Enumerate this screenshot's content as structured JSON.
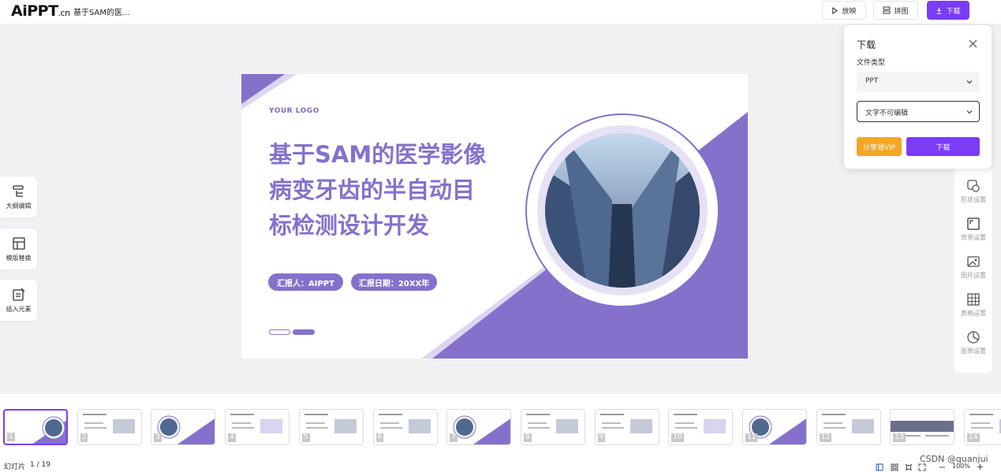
{
  "app": {
    "logo_main": "AiPPT",
    "logo_suffix": ".cn",
    "doc_title": "基于SAM的医..."
  },
  "toolbar": {
    "play_label": "放映",
    "collage_label": "拼图",
    "download_label": "下载",
    "accent_color": "#7b3cf5"
  },
  "left_tools": [
    {
      "label": "大纲编辑",
      "icon": "outline-icon"
    },
    {
      "label": "模版替换",
      "icon": "template-icon"
    },
    {
      "label": "插入元素",
      "icon": "insert-element-icon"
    }
  ],
  "right_tools": [
    {
      "label": "形状设置",
      "icon": "shape-icon"
    },
    {
      "label": "背景设置",
      "icon": "background-icon"
    },
    {
      "label": "图片设置",
      "icon": "image-icon"
    },
    {
      "label": "表格设置",
      "icon": "table-icon"
    },
    {
      "label": "图表设置",
      "icon": "chart-icon"
    }
  ],
  "download_panel": {
    "title": "下载",
    "file_type_label": "文件类型",
    "file_type_value": "PPT",
    "edit_mode_value": "文字不可编辑",
    "vip_button": "分享领VIP",
    "download_button": "下载"
  },
  "slide": {
    "logo_text": "YOUR LOGO",
    "title_lines": [
      "基于SAM的医学影像",
      "病变牙齿的半自动目",
      "标检测设计开发"
    ],
    "reporter": "汇报人：AIPPT",
    "report_date": "汇报日期：20XX年",
    "theme_color": "#8571cc"
  },
  "thumbnails": {
    "numbers": [
      "1",
      "2",
      "3",
      "4",
      "5",
      "6",
      "7",
      "8",
      "9",
      "10",
      "11",
      "12",
      "13",
      "14"
    ],
    "selected": "1"
  },
  "status": {
    "slide_label": "幻灯片",
    "slide_counter": "1 / 19",
    "zoom": "100%",
    "watermark": "CSDN @quanjui"
  }
}
